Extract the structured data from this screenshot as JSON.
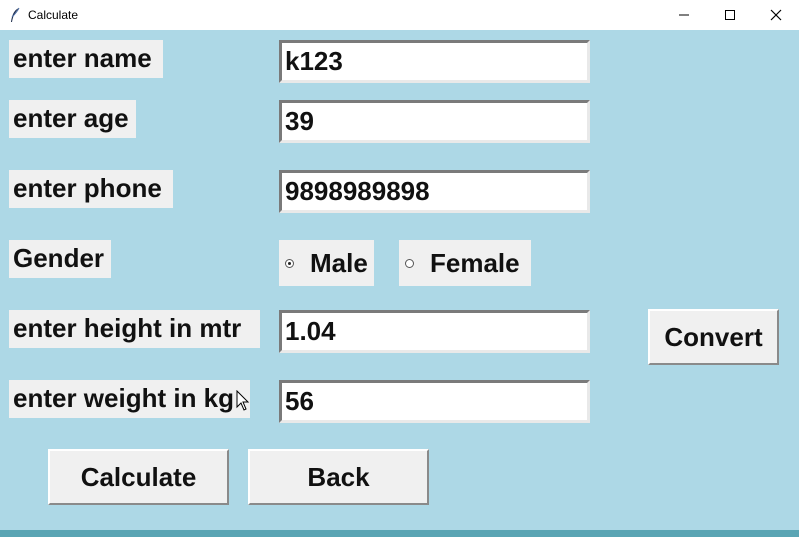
{
  "window": {
    "title": "Calculate",
    "icons": {
      "app": "feather-icon",
      "minimize": "minimize-icon",
      "maximize": "maximize-icon",
      "close": "close-icon"
    }
  },
  "form": {
    "name_label": "enter name",
    "name_value": "k123",
    "age_label": "enter age",
    "age_value": "39",
    "phone_label": "enter phone",
    "phone_value": "9898989898",
    "gender_label": "Gender",
    "gender_options": [
      {
        "label": "Male",
        "selected": true
      },
      {
        "label": "Female",
        "selected": false
      }
    ],
    "height_label": "enter height in mtr",
    "height_value": "1.04",
    "weight_label": "enter weight in kg",
    "weight_value": "56"
  },
  "buttons": {
    "convert": "Convert",
    "calculate": "Calculate",
    "back": "Back"
  },
  "colors": {
    "background": "#add8e6",
    "widget": "#f0f0f0"
  }
}
